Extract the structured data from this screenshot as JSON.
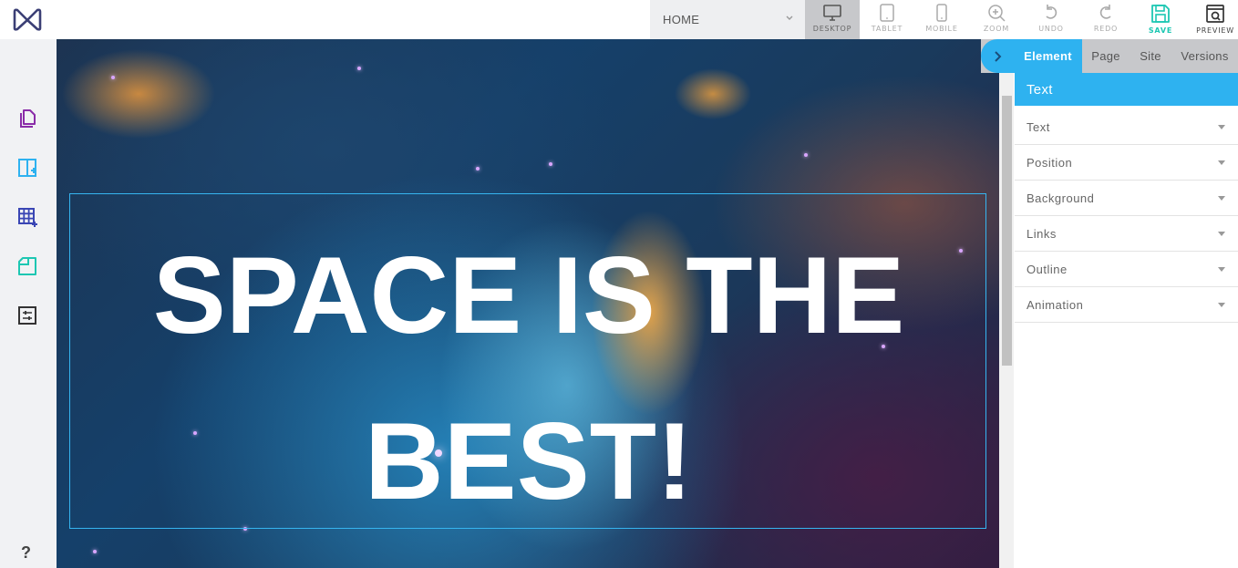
{
  "toolbar": {
    "page_select": "HOME",
    "tools": [
      {
        "id": "desktop",
        "label": "DESKTOP"
      },
      {
        "id": "tablet",
        "label": "TABLET"
      },
      {
        "id": "mobile",
        "label": "MOBILE"
      },
      {
        "id": "zoom",
        "label": "ZOOM"
      },
      {
        "id": "undo",
        "label": "UNDO"
      },
      {
        "id": "redo",
        "label": "REDO"
      },
      {
        "id": "save",
        "label": "SAVE"
      },
      {
        "id": "preview",
        "label": "PREVIEW"
      }
    ],
    "active_tool": "desktop"
  },
  "left_sidebar": {
    "icons": [
      "pages-icon",
      "add-section-icon",
      "add-grid-icon",
      "add-element-icon",
      "settings-sliders-icon"
    ],
    "help_label": "?"
  },
  "canvas": {
    "headline": "SPACE IS THE BEST!"
  },
  "right_panel": {
    "tabs": [
      "Element",
      "Page",
      "Site",
      "Versions"
    ],
    "active_tab": "Element",
    "header": "Text",
    "sections": [
      "Text",
      "Position",
      "Background",
      "Links",
      "Outline",
      "Animation"
    ]
  },
  "colors": {
    "accent": "#2eb2f0",
    "save": "#1dc7b2",
    "logo": "#5a4fa8"
  }
}
